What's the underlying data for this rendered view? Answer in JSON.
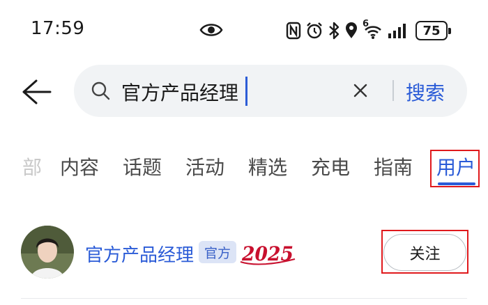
{
  "status_bar": {
    "time": "17:59",
    "battery": "75",
    "signal_label": "6",
    "icons": [
      "eye-icon",
      "nfc-icon",
      "alarm-icon",
      "bluetooth-icon",
      "location-icon",
      "wifi-icon",
      "signal-icon",
      "battery-icon"
    ]
  },
  "search": {
    "query": "官方产品经理",
    "button_label": "搜索",
    "icons": [
      "back-icon",
      "search-icon",
      "clear-icon"
    ]
  },
  "tabs": [
    {
      "label": "部",
      "state": "faded"
    },
    {
      "label": "内容",
      "state": "normal"
    },
    {
      "label": "话题",
      "state": "normal"
    },
    {
      "label": "活动",
      "state": "normal"
    },
    {
      "label": "精选",
      "state": "normal"
    },
    {
      "label": "充电",
      "state": "normal"
    },
    {
      "label": "指南",
      "state": "normal"
    },
    {
      "label": "用户",
      "state": "active"
    }
  ],
  "results": [
    {
      "name": "官方产品经理",
      "badge": "官方",
      "year_badge": "2025",
      "follow_label": "关注"
    }
  ],
  "colors": {
    "accent": "#2a5bd7",
    "highlight": "#e0191c",
    "search_bg": "#f1f3f5"
  }
}
